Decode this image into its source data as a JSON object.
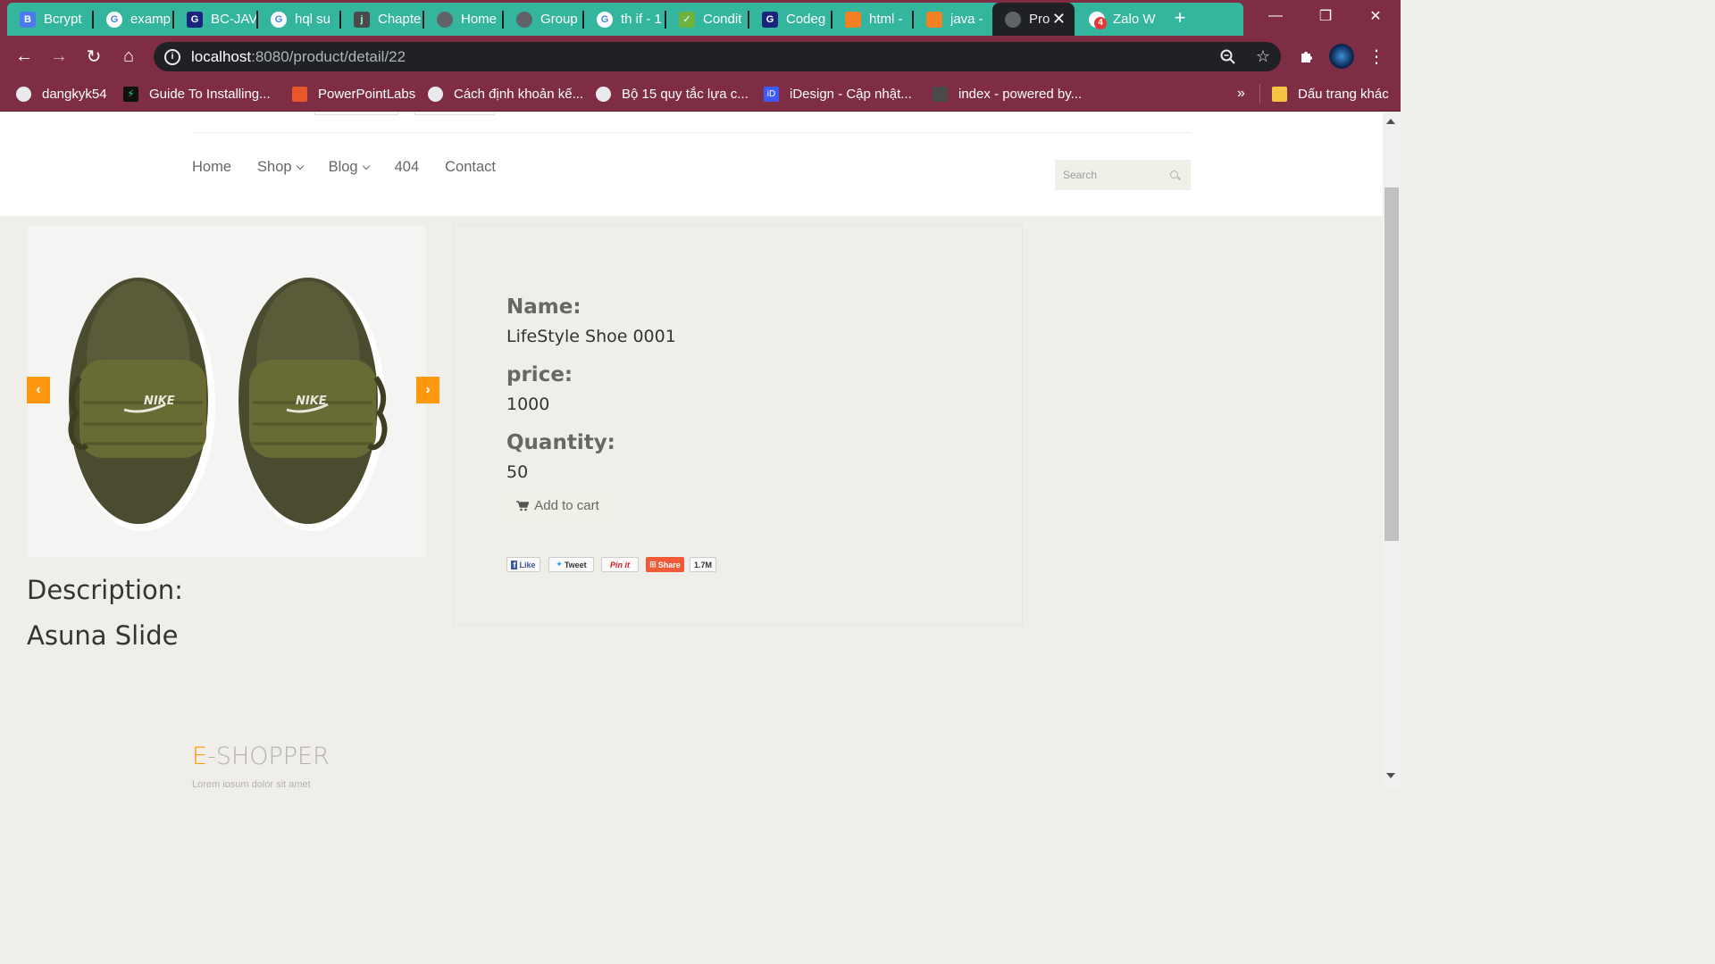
{
  "browser": {
    "tabs": [
      {
        "title": "Bcrypt",
        "icon": "bootstrap-icon",
        "icon_color": "#563d7c",
        "icon_text": "B"
      },
      {
        "title": "examp",
        "icon": "google-icon",
        "icon_color": "#ffffff",
        "icon_text": "G"
      },
      {
        "title": "BC-JAV",
        "icon": "codegym-icon",
        "icon_color": "#1a237e",
        "icon_text": "G"
      },
      {
        "title": "hql su",
        "icon": "google-icon",
        "icon_color": "#ffffff",
        "icon_text": "G"
      },
      {
        "title": "Chapte",
        "icon": "jboss-icon",
        "icon_color": "#4a4a4a",
        "icon_text": "j"
      },
      {
        "title": "Home",
        "icon": "globe-icon",
        "icon_color": "#5f6368",
        "icon_text": ""
      },
      {
        "title": "Group",
        "icon": "globe-icon",
        "icon_color": "#5f6368",
        "icon_text": ""
      },
      {
        "title": "th if - 1",
        "icon": "google-icon",
        "icon_color": "#ffffff",
        "icon_text": "G"
      },
      {
        "title": "Condit",
        "icon": "spring-icon",
        "icon_color": "#6db33f",
        "icon_text": ""
      },
      {
        "title": "Codeg",
        "icon": "codegym-icon",
        "icon_color": "#1a237e",
        "icon_text": "G"
      },
      {
        "title": "html - ",
        "icon": "stackoverflow-icon",
        "icon_color": "#f48024",
        "icon_text": ""
      },
      {
        "title": "java - ",
        "icon": "stackoverflow-icon",
        "icon_color": "#f48024",
        "icon_text": ""
      },
      {
        "title": "Pro",
        "icon": "globe-icon",
        "icon_color": "#5f6368",
        "icon_text": "",
        "active": true
      },
      {
        "title": "Zalo W",
        "icon": "zalo-icon",
        "icon_color": "#ffffff",
        "icon_text": "4"
      }
    ],
    "address": {
      "host": "localhost",
      "path": ":8080/product/detail/22"
    },
    "bookmarks": [
      {
        "label": "dangkyk54",
        "icon": "globe-icon"
      },
      {
        "label": "Guide To Installing...",
        "icon": "zap-icon"
      },
      {
        "label": "PowerPointLabs",
        "icon": "powerpoint-icon"
      },
      {
        "label": "Cách định khoản kế...",
        "icon": "globe-icon"
      },
      {
        "label": "Bộ 15 quy tắc lựa c...",
        "icon": "globe-icon"
      },
      {
        "label": "iDesign - Cập nhật...",
        "icon": "idesign-icon"
      },
      {
        "label": "index - powered by...",
        "icon": "folder-icon"
      }
    ],
    "bookmarks_more": "»",
    "other_bookmarks": "Dấu trang khác"
  },
  "nav": {
    "home": "Home",
    "shop": "Shop",
    "blog": "Blog",
    "notfound": "404",
    "contact": "Contact",
    "search_placeholder": "Search"
  },
  "product": {
    "name_label": "Name:",
    "name": "LifeStyle Shoe 0001",
    "price_label": "price:",
    "price": "1000",
    "quantity_label": "Quantity:",
    "quantity": "50",
    "add_to_cart": "Add to cart",
    "description_label": "Description:",
    "description": "Asuna Slide",
    "image_brand": "NIKE"
  },
  "share": {
    "like": "Like",
    "tweet": "Tweet",
    "pinit": "Pin it",
    "share": "Share",
    "count": "1.7M"
  },
  "footer": {
    "logo_e": "E",
    "logo_rest": "-SHOPPER",
    "tagline": "Lorem ipsum dolor sit amet"
  },
  "colors": {
    "accent": "#fe980f",
    "tabstrip": "#7e2d45",
    "tab_group": "#33b59e"
  }
}
